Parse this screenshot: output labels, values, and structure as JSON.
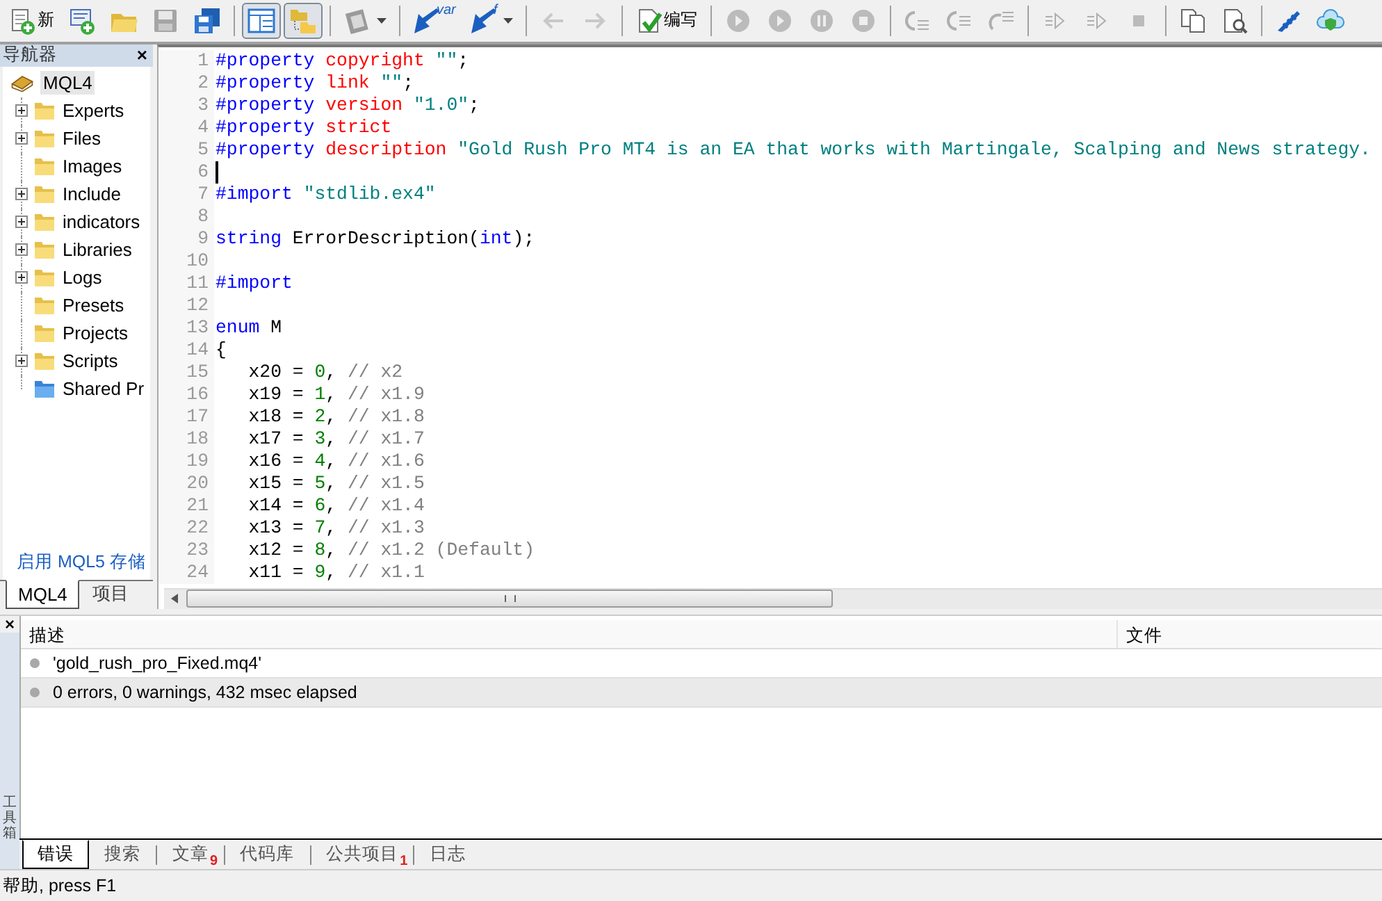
{
  "toolbar": [
    {
      "buttons": [
        {
          "label": "新",
          "disabled": false,
          "pressed": false
        },
        {
          "disabled": false,
          "pressed": false
        },
        {
          "disabled": false,
          "pressed": false
        },
        {
          "disabled": true,
          "pressed": false
        },
        {
          "disabled": false,
          "pressed": false
        }
      ]
    },
    {
      "buttons": [
        {
          "disabled": false,
          "pressed": true
        },
        {
          "disabled": false,
          "pressed": true
        }
      ]
    },
    {
      "buttons": [
        {
          "disabled": false,
          "pressed": false,
          "dropdown": true
        }
      ]
    },
    {
      "buttons": [
        {
          "sup": "var",
          "disabled": false,
          "pressed": false
        },
        {
          "sup": "f",
          "disabled": false,
          "pressed": false,
          "dropdown": true
        }
      ]
    },
    {
      "buttons": [
        {
          "disabled": true,
          "pressed": false
        },
        {
          "disabled": true,
          "pressed": false
        }
      ]
    },
    {
      "buttons": [
        {
          "label": "编写",
          "disabled": false,
          "pressed": false
        }
      ]
    },
    {
      "buttons": [
        {
          "disabled": true,
          "pressed": false
        },
        {
          "disabled": true,
          "pressed": false
        },
        {
          "disabled": true,
          "pressed": false
        },
        {
          "disabled": true,
          "pressed": false
        }
      ]
    },
    {
      "buttons": [
        {
          "disabled": true,
          "pressed": false
        },
        {
          "disabled": true,
          "pressed": false
        },
        {
          "disabled": true,
          "pressed": false
        }
      ]
    },
    {
      "buttons": [
        {
          "disabled": true,
          "pressed": false
        },
        {
          "disabled": true,
          "pressed": false
        },
        {
          "disabled": true,
          "pressed": false
        }
      ]
    },
    {
      "buttons": [
        {
          "disabled": false,
          "pressed": false
        },
        {
          "disabled": false,
          "pressed": false
        }
      ]
    },
    {
      "buttons": [
        {
          "disabled": false,
          "pressed": false
        },
        {
          "disabled": false,
          "pressed": false
        }
      ]
    }
  ],
  "navigator": {
    "title": "导航器",
    "close": "×",
    "root": {
      "label": "MQL4",
      "selected": true,
      "children": [
        {
          "label": "Experts",
          "expandable": true,
          "kind": "folder",
          "selected": false
        },
        {
          "label": "Files",
          "expandable": true,
          "kind": "folder",
          "selected": false
        },
        {
          "label": "Images",
          "expandable": false,
          "kind": "folder",
          "selected": false
        },
        {
          "label": "Include",
          "expandable": true,
          "kind": "folder",
          "selected": false
        },
        {
          "label": "indicators",
          "expandable": true,
          "kind": "folder",
          "selected": false
        },
        {
          "label": "Libraries",
          "expandable": true,
          "kind": "folder",
          "selected": false
        },
        {
          "label": "Logs",
          "expandable": true,
          "kind": "folder",
          "selected": false
        },
        {
          "label": "Presets",
          "expandable": false,
          "kind": "folder",
          "selected": false
        },
        {
          "label": "Projects",
          "expandable": false,
          "kind": "folder",
          "selected": false
        },
        {
          "label": "Scripts",
          "expandable": true,
          "kind": "folder",
          "selected": false
        },
        {
          "label": "Shared Pr",
          "expandable": false,
          "kind": "shared",
          "selected": false
        }
      ]
    },
    "link": "启用 MQL5 存储",
    "tabs": [
      {
        "label": "MQL4",
        "selected": true
      },
      {
        "label": "项目",
        "selected": false
      }
    ]
  },
  "editor": {
    "lines": [
      {
        "n": "1",
        "caret": false,
        "tokens": [
          {
            "kind": "kw",
            "t": "#property"
          },
          {
            "kind": "prop",
            "t": " copyright"
          },
          {
            "kind": "str",
            "t": " \"\""
          },
          {
            "kind": "plain",
            "t": ";"
          }
        ]
      },
      {
        "n": "2",
        "caret": false,
        "tokens": [
          {
            "kind": "kw",
            "t": "#property"
          },
          {
            "kind": "prop",
            "t": " link"
          },
          {
            "kind": "str",
            "t": " \"\""
          },
          {
            "kind": "plain",
            "t": ";"
          }
        ]
      },
      {
        "n": "3",
        "caret": false,
        "tokens": [
          {
            "kind": "kw",
            "t": "#property"
          },
          {
            "kind": "prop",
            "t": " version"
          },
          {
            "kind": "str",
            "t": " \"1.0\""
          },
          {
            "kind": "plain",
            "t": ";"
          }
        ]
      },
      {
        "n": "4",
        "caret": false,
        "tokens": [
          {
            "kind": "kw",
            "t": "#property"
          },
          {
            "kind": "prop",
            "t": " strict"
          }
        ]
      },
      {
        "n": "5",
        "caret": false,
        "tokens": [
          {
            "kind": "kw",
            "t": "#property"
          },
          {
            "kind": "prop",
            "t": " description"
          },
          {
            "kind": "str",
            "t": " \"Gold Rush Pro MT4 is an EA that works with Martingale, Scalping and News strategy."
          }
        ]
      },
      {
        "n": "6",
        "caret": true
      },
      {
        "n": "7",
        "caret": false,
        "tokens": [
          {
            "kind": "kw",
            "t": "#import"
          },
          {
            "kind": "str",
            "t": " \"stdlib.ex4\""
          }
        ]
      },
      {
        "n": "8",
        "caret": false
      },
      {
        "n": "9",
        "caret": false,
        "tokens": [
          {
            "kind": "kw",
            "t": "string"
          },
          {
            "kind": "plain",
            "t": " ErrorDescription("
          },
          {
            "kind": "kw",
            "t": "int"
          },
          {
            "kind": "plain",
            "t": ");"
          }
        ]
      },
      {
        "n": "10",
        "caret": false
      },
      {
        "n": "11",
        "caret": false,
        "tokens": [
          {
            "kind": "kw",
            "t": "#import"
          }
        ]
      },
      {
        "n": "12",
        "caret": false
      },
      {
        "n": "13",
        "caret": false,
        "tokens": [
          {
            "kind": "kw",
            "t": "enum"
          },
          {
            "kind": "plain",
            "t": " M"
          }
        ]
      },
      {
        "n": "14",
        "caret": false,
        "tokens": [
          {
            "kind": "plain",
            "t": "{"
          }
        ]
      },
      {
        "n": "15",
        "caret": false,
        "tokens": [
          {
            "kind": "plain",
            "t": "   x20 ="
          },
          {
            "kind": "num",
            "t": " 0"
          },
          {
            "kind": "plain",
            "t": ","
          },
          {
            "kind": "comment",
            "t": " // x2"
          }
        ]
      },
      {
        "n": "16",
        "caret": false,
        "tokens": [
          {
            "kind": "plain",
            "t": "   x19 ="
          },
          {
            "kind": "num",
            "t": " 1"
          },
          {
            "kind": "plain",
            "t": ","
          },
          {
            "kind": "comment",
            "t": " // x1.9"
          }
        ]
      },
      {
        "n": "17",
        "caret": false,
        "tokens": [
          {
            "kind": "plain",
            "t": "   x18 ="
          },
          {
            "kind": "num",
            "t": " 2"
          },
          {
            "kind": "plain",
            "t": ","
          },
          {
            "kind": "comment",
            "t": " // x1.8"
          }
        ]
      },
      {
        "n": "18",
        "caret": false,
        "tokens": [
          {
            "kind": "plain",
            "t": "   x17 ="
          },
          {
            "kind": "num",
            "t": " 3"
          },
          {
            "kind": "plain",
            "t": ","
          },
          {
            "kind": "comment",
            "t": " // x1.7"
          }
        ]
      },
      {
        "n": "19",
        "caret": false,
        "tokens": [
          {
            "kind": "plain",
            "t": "   x16 ="
          },
          {
            "kind": "num",
            "t": " 4"
          },
          {
            "kind": "plain",
            "t": ","
          },
          {
            "kind": "comment",
            "t": " // x1.6"
          }
        ]
      },
      {
        "n": "20",
        "caret": false,
        "tokens": [
          {
            "kind": "plain",
            "t": "   x15 ="
          },
          {
            "kind": "num",
            "t": " 5"
          },
          {
            "kind": "plain",
            "t": ","
          },
          {
            "kind": "comment",
            "t": " // x1.5"
          }
        ]
      },
      {
        "n": "21",
        "caret": false,
        "tokens": [
          {
            "kind": "plain",
            "t": "   x14 ="
          },
          {
            "kind": "num",
            "t": " 6"
          },
          {
            "kind": "plain",
            "t": ","
          },
          {
            "kind": "comment",
            "t": " // x1.4"
          }
        ]
      },
      {
        "n": "22",
        "caret": false,
        "tokens": [
          {
            "kind": "plain",
            "t": "   x13 ="
          },
          {
            "kind": "num",
            "t": " 7"
          },
          {
            "kind": "plain",
            "t": ","
          },
          {
            "kind": "comment",
            "t": " // x1.3"
          }
        ]
      },
      {
        "n": "23",
        "caret": false,
        "tokens": [
          {
            "kind": "plain",
            "t": "   x12 ="
          },
          {
            "kind": "num",
            "t": " 8"
          },
          {
            "kind": "plain",
            "t": ","
          },
          {
            "kind": "comment",
            "t": " // x1.2 (Default)"
          }
        ]
      },
      {
        "n": "24",
        "caret": false,
        "tokens": [
          {
            "kind": "plain",
            "t": "   x11 ="
          },
          {
            "kind": "num",
            "t": " 9"
          },
          {
            "kind": "plain",
            "t": ","
          },
          {
            "kind": "comment",
            "t": " // x1.1"
          }
        ]
      }
    ]
  },
  "toolbox": {
    "close": "×",
    "side_title": "工具箱",
    "columns": [
      "描述",
      "文件"
    ],
    "rows": [
      {
        "text": "'gold_rush_pro_Fixed.mq4'",
        "selected": false
      },
      {
        "text": "0 errors, 0 warnings, 432 msec elapsed",
        "selected": true
      }
    ],
    "tabs": [
      {
        "label": "错误",
        "selected": true
      },
      {
        "label": "搜索",
        "selected": false
      },
      {
        "label": "文章",
        "badge": "9",
        "selected": false
      },
      {
        "label": "代码库",
        "selected": false
      },
      {
        "label": "公共项目",
        "badge": "1",
        "selected": false
      },
      {
        "label": "日志",
        "selected": false
      }
    ]
  },
  "status_bar": "帮助, press F1"
}
